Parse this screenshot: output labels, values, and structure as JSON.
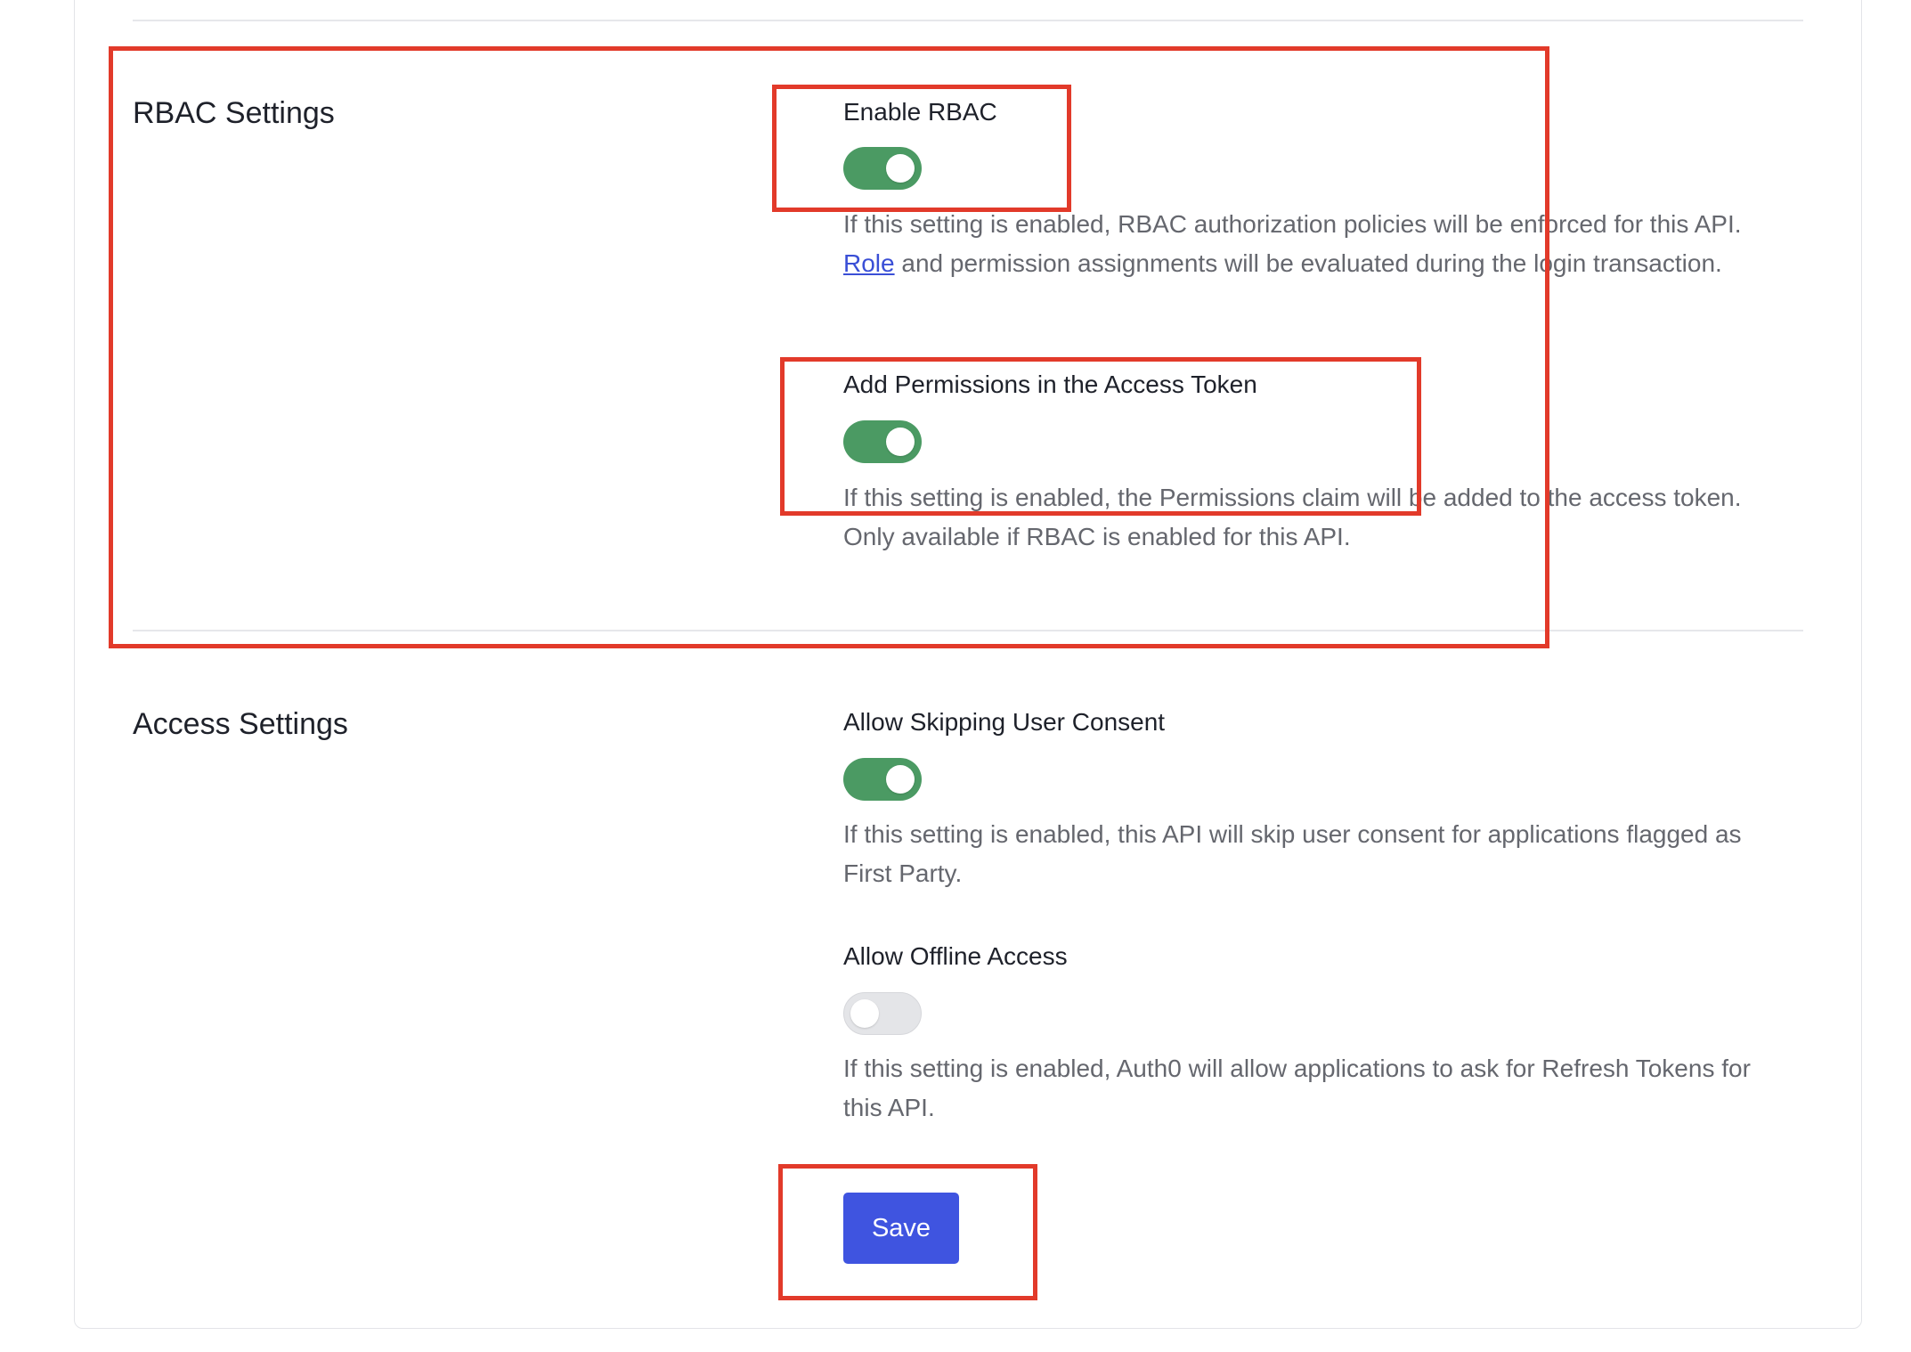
{
  "rbac": {
    "title": "RBAC Settings",
    "enable_rbac": {
      "label": "Enable RBAC",
      "enabled": true,
      "desc_before": "If this setting is enabled, RBAC authorization policies will be enforced for this API. ",
      "link_text": "Role",
      "desc_after": " and permission assignments will be evaluated during the login transaction."
    },
    "add_permissions": {
      "label": "Add Permissions in the Access Token",
      "enabled": true,
      "desc": "If this setting is enabled, the Permissions claim will be added to the access token. Only available if RBAC is enabled for this API."
    }
  },
  "access": {
    "title": "Access Settings",
    "skip_consent": {
      "label": "Allow Skipping User Consent",
      "enabled": true,
      "desc": "If this setting is enabled, this API will skip user consent for applications flagged as First Party."
    },
    "offline_access": {
      "label": "Allow Offline Access",
      "enabled": false,
      "desc": "If this setting is enabled, Auth0 will allow applications to ask for Refresh Tokens for this API."
    }
  },
  "actions": {
    "save_label": "Save"
  },
  "colors": {
    "toggle_on": "#4b9a63",
    "toggle_off": "#e4e5e8",
    "primary_button": "#3f54e0",
    "link": "#3a4fd6",
    "annotation": "#e23a2a"
  }
}
